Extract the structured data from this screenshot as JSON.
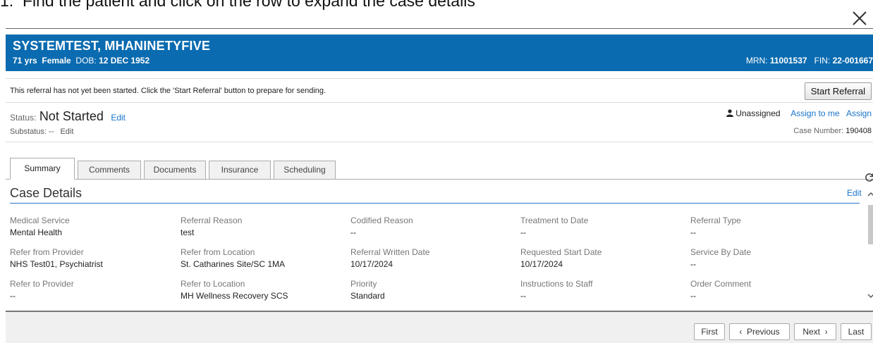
{
  "instruction": "Find the patient and click on the row to expand the case details",
  "patient": {
    "name": "SYSTEMTEST, MHANINETYFIVE",
    "age": "71 yrs",
    "sex": "Female",
    "dob_label": "DOB:",
    "dob": "12 DEC 1952",
    "mrn_label": "MRN:",
    "mrn": "11001537",
    "fin_label": "FIN:",
    "fin": "22-001667"
  },
  "notice": {
    "message": "This referral has not yet been started. Click the 'Start Referral' button to prepare for sending.",
    "start_button": "Start Referral"
  },
  "status": {
    "label": "Status:",
    "value": "Not Started",
    "edit": "Edit",
    "substatus_label": "Substatus:",
    "substatus_value": "--",
    "substatus_edit": "Edit",
    "assignee": "Unassigned",
    "assign_to_me": "Assign to me",
    "assign": "Assign",
    "case_number_label": "Case Number:",
    "case_number": "190408"
  },
  "tabs": [
    {
      "label": "Summary",
      "active": true
    },
    {
      "label": "Comments",
      "active": false
    },
    {
      "label": "Documents",
      "active": false
    },
    {
      "label": "Insurance",
      "active": false
    },
    {
      "label": "Scheduling",
      "active": false
    }
  ],
  "case_details": {
    "title": "Case Details",
    "edit": "Edit",
    "fields": [
      {
        "label": "Medical Service",
        "value": "Mental Health"
      },
      {
        "label": "Referral Reason",
        "value": "test"
      },
      {
        "label": "Codified Reason",
        "value": "--"
      },
      {
        "label": "Treatment to Date",
        "value": "--"
      },
      {
        "label": "Referral Type",
        "value": "--"
      },
      {
        "label": "Refer from Provider",
        "value": "NHS Test01, Psychiatrist"
      },
      {
        "label": "Refer from Location",
        "value": "St. Catharines Site/SC 1MA"
      },
      {
        "label": "Referral Written Date",
        "value": "10/17/2024"
      },
      {
        "label": "Requested Start Date",
        "value": "10/17/2024"
      },
      {
        "label": "Service By Date",
        "value": "--"
      },
      {
        "label": "Refer to Provider",
        "value": "--"
      },
      {
        "label": "Refer to Location",
        "value": "MH Wellness Recovery SCS"
      },
      {
        "label": "Priority",
        "value": "Standard"
      },
      {
        "label": "Instructions to Staff",
        "value": "--"
      },
      {
        "label": "Order Comment",
        "value": "--"
      }
    ]
  },
  "pagination": {
    "first": "First",
    "previous": "Previous",
    "next": "Next",
    "last": "Last"
  },
  "icons": [
    "close-icon",
    "person-icon",
    "refresh-icon",
    "chevron-up-icon",
    "chevron-down-icon",
    "chevron-left-icon",
    "chevron-right-icon"
  ],
  "colors": {
    "banner": "#0a6bb0",
    "link": "#1a73c9"
  }
}
